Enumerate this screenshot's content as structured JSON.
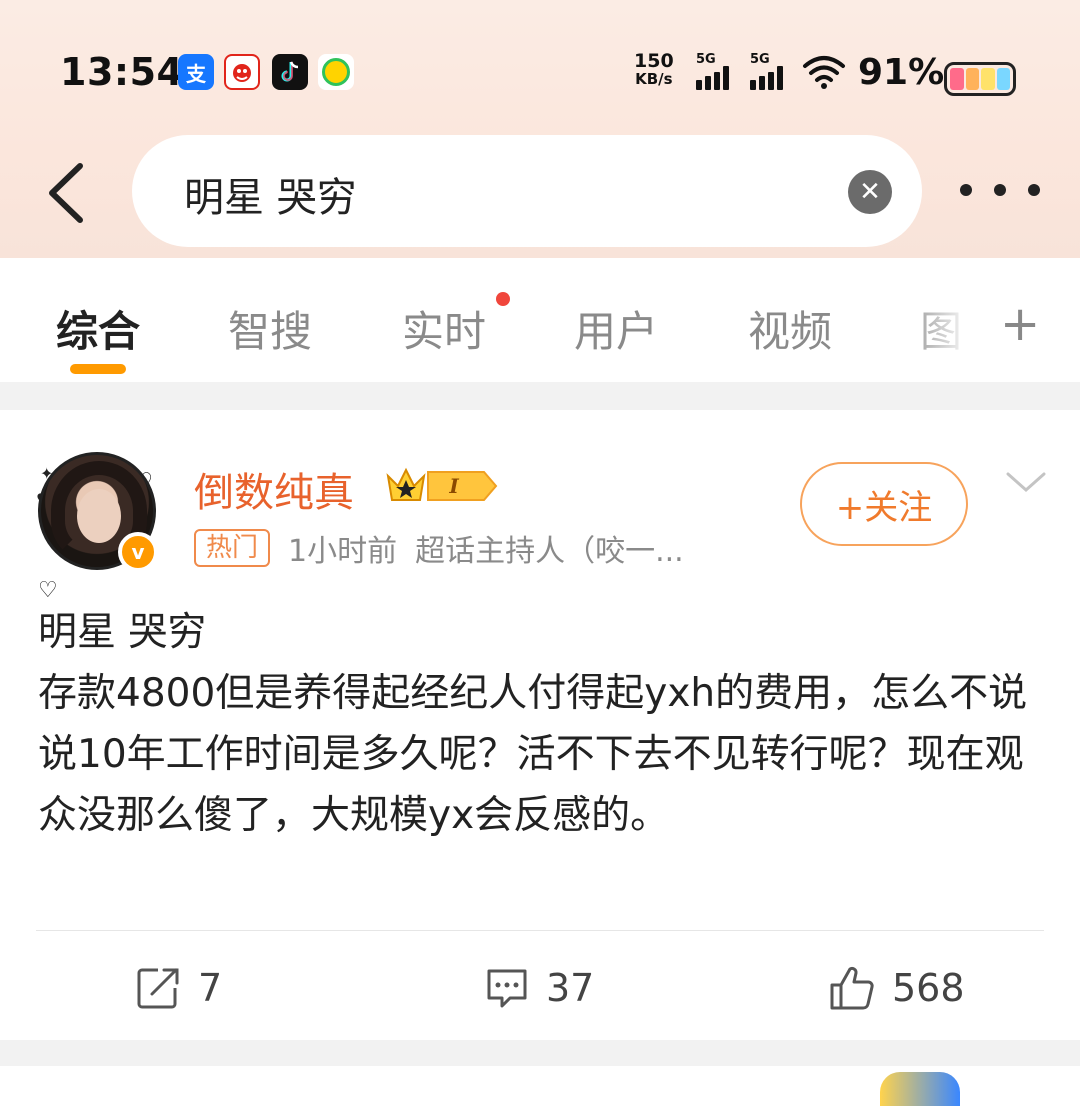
{
  "status_bar": {
    "time": "13:54",
    "app_icons": [
      "alipay-icon",
      "jd-icon",
      "tiktok-icon",
      "music-icon"
    ],
    "alipay_glyph": "支",
    "net_speed_value": "150",
    "net_speed_unit": "KB/s",
    "signal_1_label": "5G",
    "signal_2_label": "5G",
    "battery": "91%",
    "battery_colors": [
      "#ff6b8a",
      "#ffb25b",
      "#ffe26a",
      "#7ad7ff"
    ]
  },
  "search": {
    "query": "明星 哭穷",
    "clear_glyph": "✕"
  },
  "tabs": [
    {
      "label": "综合",
      "active": true
    },
    {
      "label": "智搜",
      "active": false
    },
    {
      "label": "实时",
      "active": false,
      "has_dot": true
    },
    {
      "label": "用户",
      "active": false
    },
    {
      "label": "视频",
      "active": false
    },
    {
      "label": "图",
      "active": false
    }
  ],
  "add_tab_glyph": "+",
  "post": {
    "username": "倒数纯真",
    "badge_level": "I",
    "verify_glyph": "v",
    "tag": "热门",
    "time_ago": "1小时前",
    "source": "超话主持人（咬一...",
    "follow_label": "+关注",
    "title_line": "明星 哭穷",
    "body": "存款4800但是养得起经纪人付得起yxh的费用，怎么不说说10年工作时间是多久呢？活不下去不见转行呢？现在观众没那么傻了，大规模yx会反感的。",
    "reposts": "7",
    "comments": "37",
    "likes": "568"
  },
  "colors": {
    "accent": "#ff9a00",
    "username": "#e8622c",
    "follow": "#f07a2c"
  }
}
